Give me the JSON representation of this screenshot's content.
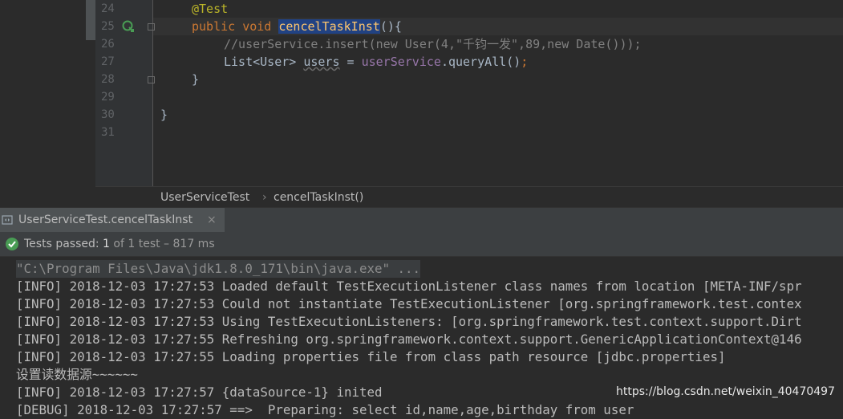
{
  "editor": {
    "line_numbers": [
      "24",
      "25",
      "26",
      "27",
      "28",
      "29",
      "30",
      "31"
    ],
    "annotation": "@Test",
    "kw_public": "public",
    "kw_void": "void",
    "method_name": "cencelTaskInst",
    "method_tail": "(){",
    "comment_line": "//userService.insert(new User(4,\"千钧一发\",89,new Date()));",
    "line27_type": "List<User> ",
    "line27_var": "users",
    "line27_eq": " = ",
    "line27_field": "userService",
    "line27_call": ".queryAll()",
    "line27_semi": ";",
    "close_method": "}",
    "close_class": "}"
  },
  "breadcrumb": {
    "class_name": "UserServiceTest",
    "separator": "›",
    "method": "cencelTaskInst()"
  },
  "run_tab": {
    "label": "UserServiceTest.cencelTaskInst",
    "close": "×"
  },
  "test_status": {
    "prefix": "Tests passed: ",
    "count": "1",
    "suffix": " of 1 test – 817 ms"
  },
  "console": {
    "lines": [
      "\"C:\\Program Files\\Java\\jdk1.8.0_171\\bin\\java.exe\" ...",
      "[INFO] 2018-12-03 17:27:53 Loaded default TestExecutionListener class names from location [META-INF/spr",
      "[INFO] 2018-12-03 17:27:53 Could not instantiate TestExecutionListener [org.springframework.test.contex",
      "[INFO] 2018-12-03 17:27:53 Using TestExecutionListeners: [org.springframework.test.context.support.Dirt",
      "[INFO] 2018-12-03 17:27:55 Refreshing org.springframework.context.support.GenericApplicationContext@146",
      "[INFO] 2018-12-03 17:27:55 Loading properties file from class path resource [jdbc.properties]",
      "设置读数据源~~~~~~",
      "[INFO] 2018-12-03 17:27:57 {dataSource-1} inited",
      "[DEBUG] 2018-12-03 17:27:57 ==>  Preparing: select id,name,age,birthday from user"
    ]
  },
  "watermark": "https://blog.csdn.net/weixin_40470497",
  "colors": {
    "background": "#2b2b2b",
    "keyword": "#cc7832",
    "annotation": "#bbb529",
    "method_highlight": "#214283",
    "field": "#9876aa",
    "pass_green": "#499c54"
  },
  "icons": [
    "run-test-icon",
    "fold-icon",
    "run-tab-icon",
    "test-passed-icon"
  ]
}
